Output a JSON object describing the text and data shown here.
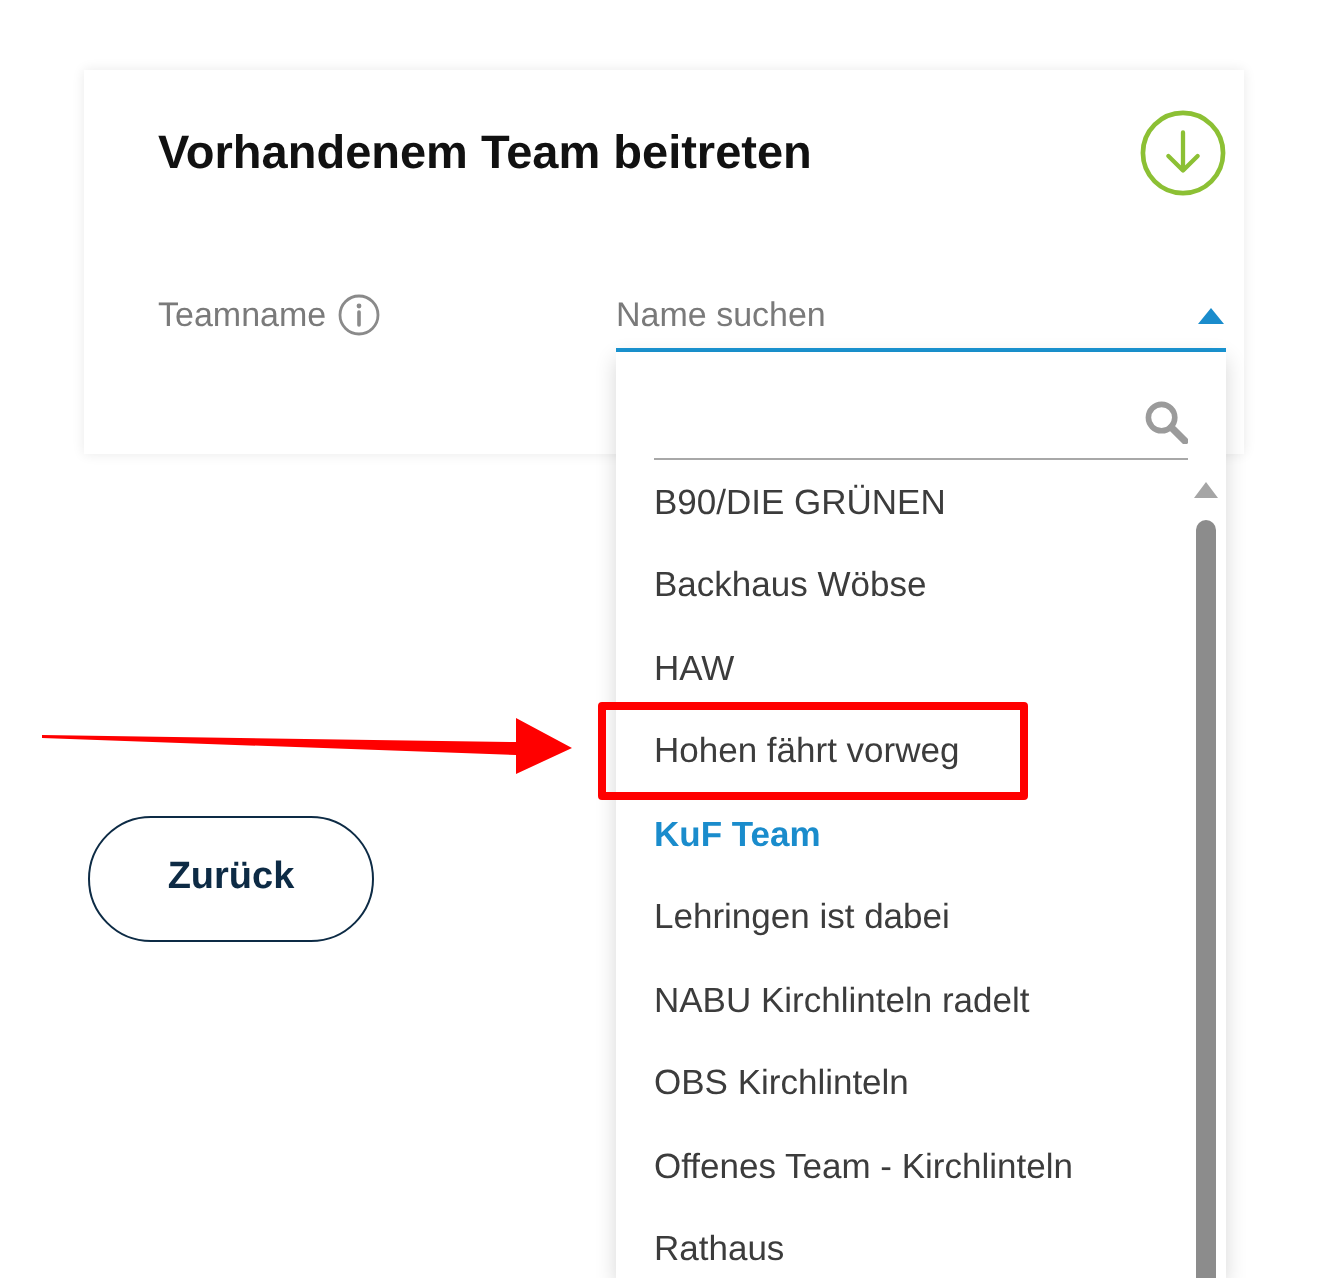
{
  "panel": {
    "title": "Vorhandenem Team beitreten"
  },
  "team_field": {
    "label": "Teamname",
    "placeholder": "Name suchen",
    "expanded": true
  },
  "dropdown": {
    "items": [
      {
        "label": "B90/DIE GRÜNEN",
        "selected": false,
        "highlighted": false
      },
      {
        "label": "Backhaus Wöbse",
        "selected": false,
        "highlighted": false
      },
      {
        "label": "HAW",
        "selected": false,
        "highlighted": false
      },
      {
        "label": "Hohen fährt vorweg",
        "selected": false,
        "highlighted": true
      },
      {
        "label": "KuF Team",
        "selected": true,
        "highlighted": false
      },
      {
        "label": "Lehringen ist dabei",
        "selected": false,
        "highlighted": false
      },
      {
        "label": "NABU Kirchlinteln radelt",
        "selected": false,
        "highlighted": false
      },
      {
        "label": "OBS Kirchlinteln",
        "selected": false,
        "highlighted": false
      },
      {
        "label": "Offenes Team - Kirchlinteln",
        "selected": false,
        "highlighted": false
      },
      {
        "label": "Rathaus",
        "selected": false,
        "highlighted": false
      }
    ]
  },
  "buttons": [
    {
      "label": "Zurück"
    }
  ]
}
